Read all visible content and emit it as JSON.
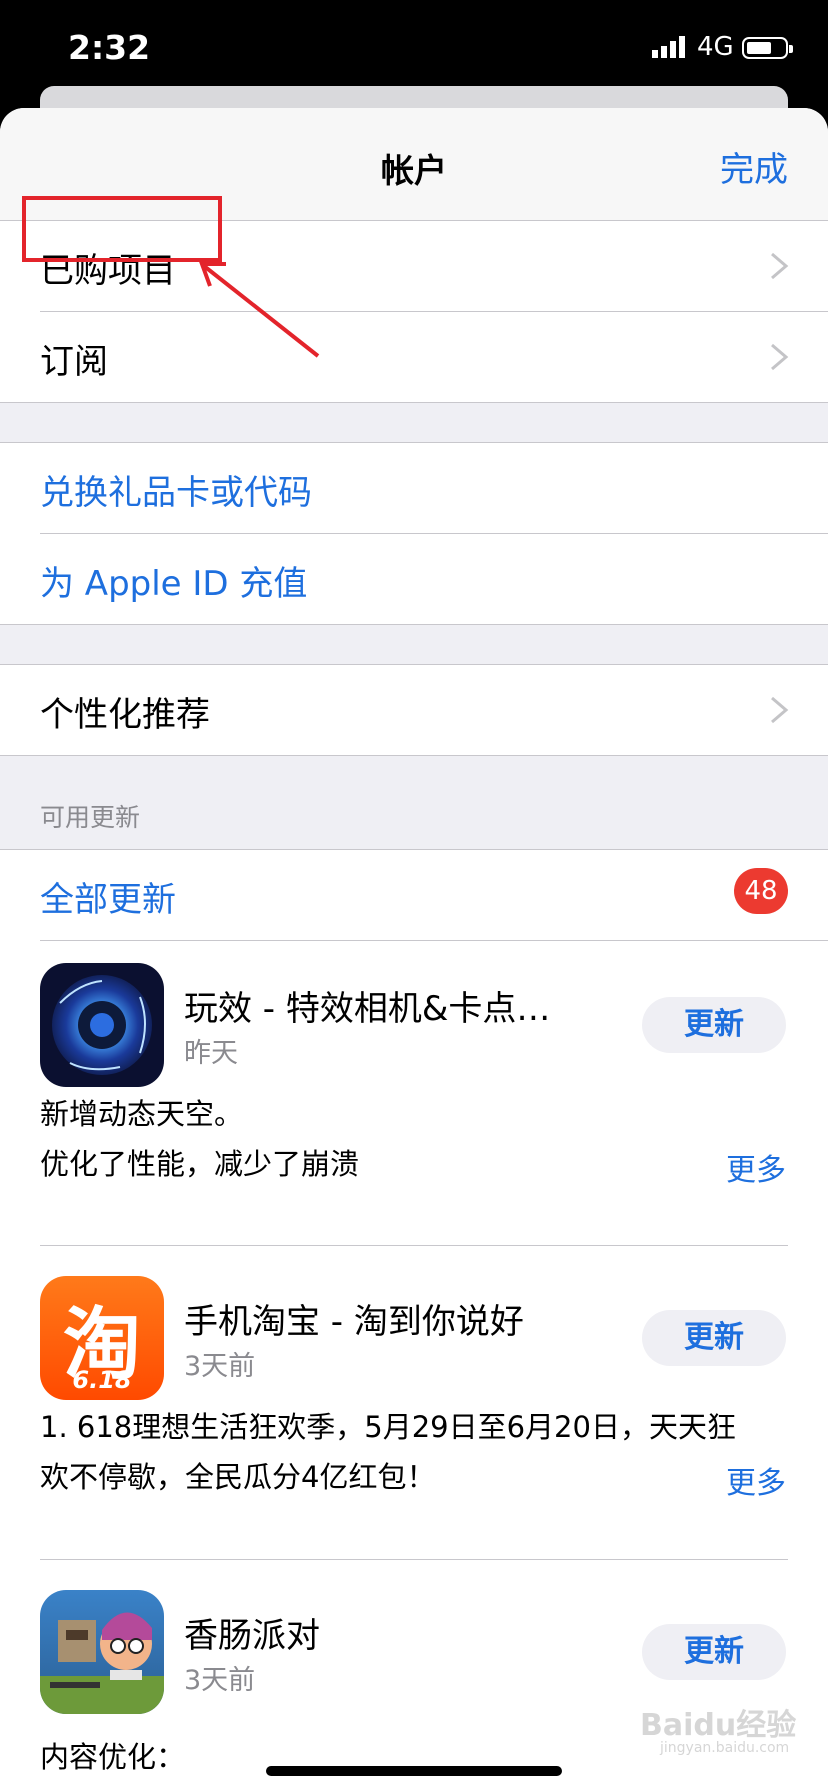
{
  "status_bar": {
    "time": "2:32",
    "network": "4G"
  },
  "nav": {
    "title": "帐户",
    "done_label": "完成"
  },
  "menu_group_1": [
    {
      "label": "已购项目"
    },
    {
      "label": "订阅"
    }
  ],
  "menu_group_2": [
    {
      "label": "兑换礼品卡或代码"
    },
    {
      "label": "为 Apple ID 充值"
    }
  ],
  "menu_group_3": [
    {
      "label": "个性化推荐"
    }
  ],
  "updates": {
    "section_header": "可用更新",
    "update_all_label": "全部更新",
    "badge_count": "48",
    "apps": [
      {
        "name": "玩效 - 特效相机&卡点视…",
        "date": "昨天",
        "button": "更新",
        "note_lines": [
          "新增动态天空。",
          "优化了性能，减少了崩溃"
        ],
        "more": "更多"
      },
      {
        "name": "手机淘宝 - 淘到你说好",
        "date": "3天前",
        "button": "更新",
        "icon_text": "淘",
        "icon_subtext": "6.18",
        "note_lines": [
          "1. 618理想生活狂欢季，5月29日至6月20日，天天狂",
          "欢不停歇，全民瓜分4亿红包！"
        ],
        "more": "更多"
      },
      {
        "name": "香肠派对",
        "date": "3天前",
        "button": "更新",
        "note_lines": [
          "内容优化："
        ]
      }
    ]
  },
  "colors": {
    "accent": "#1e6fde",
    "badge": "#ec3a30",
    "annotation": "#e3242b"
  },
  "watermark": {
    "text": "Baidu经验",
    "sub": "jingyan.baidu.com"
  }
}
